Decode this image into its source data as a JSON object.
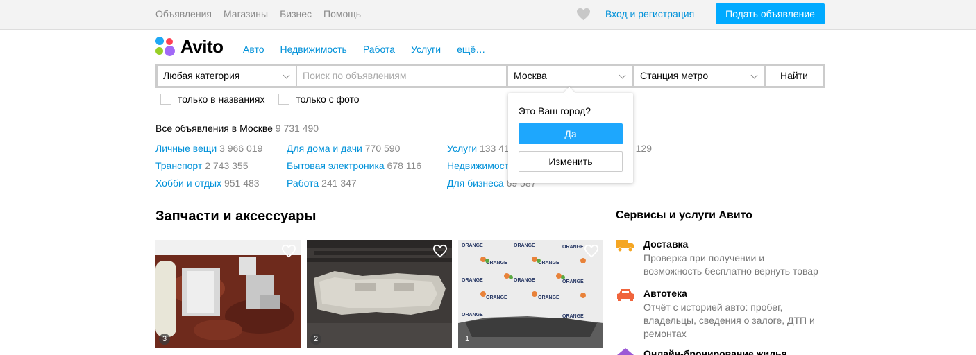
{
  "topbar": {
    "nav": [
      "Объявления",
      "Магазины",
      "Бизнес",
      "Помощь"
    ],
    "login": "Вход и регистрация",
    "post_button": "Подать объявление"
  },
  "logo": {
    "text": "Avito"
  },
  "main_nav": [
    "Авто",
    "Недвижимость",
    "Работа",
    "Услуги",
    "ещё…"
  ],
  "search": {
    "category": "Любая категория",
    "query_placeholder": "Поиск по объявлениям",
    "city": "Москва",
    "metro": "Станция метро",
    "submit": "Найти"
  },
  "filters": {
    "only_titles": "только в названиях",
    "only_photo": "только с фото"
  },
  "city_popover": {
    "question": "Это Ваш город?",
    "yes": "Да",
    "change": "Изменить"
  },
  "all_ads": {
    "label": "Все объявления в Москве",
    "count": "9 731 490"
  },
  "categories": [
    {
      "name": "Личные вещи",
      "count": "3 966 019"
    },
    {
      "name": "Транспорт",
      "count": "2 743 355"
    },
    {
      "name": "Хобби и отдых",
      "count": "951 483"
    },
    {
      "name": "Для дома и дачи",
      "count": "770 590"
    },
    {
      "name": "Бытовая электроника",
      "count": "678 116"
    },
    {
      "name": "Работа",
      "count": "241 347"
    },
    {
      "name": "Услуги",
      "count": "133 41"
    },
    {
      "name": "Недвижимост",
      "count": ""
    },
    {
      "name": "Для бизнеса",
      "count": "69 587"
    },
    {
      "name": "",
      "count": "2 129"
    }
  ],
  "section": {
    "title": "Запчасти и аксессуары"
  },
  "cards": [
    {
      "photos": "3"
    },
    {
      "photos": "2"
    },
    {
      "photos": "1",
      "watermark": "ORANGE"
    }
  ],
  "services": {
    "title": "Сервисы и услуги Авито",
    "items": [
      {
        "name": "Доставка",
        "desc": "Проверка при получении и возможность бесплатно вернуть товар",
        "color": "#f5a623"
      },
      {
        "name": "Автотека",
        "desc": "Отчёт с историей авто: пробег, владельцы, сведения о залоге, ДТП и ремонтах",
        "color": "#f0643c"
      },
      {
        "name": "Онлайн-бронирование жилья",
        "desc": "",
        "color": "#9b59d6"
      }
    ]
  },
  "colors": {
    "link": "#0091d9",
    "accent": "#00aaff"
  }
}
